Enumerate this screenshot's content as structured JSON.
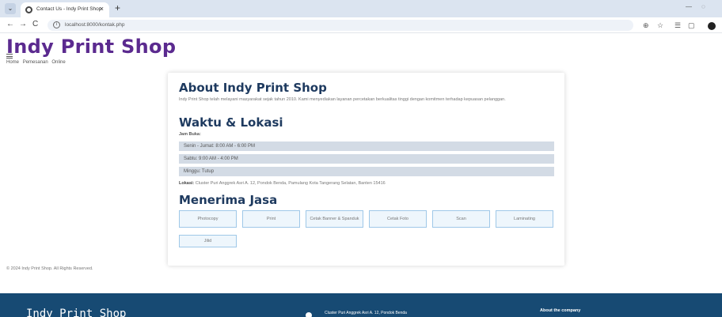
{
  "browser": {
    "tab_title": "Contact Us - Indy Print Shop",
    "tab_close": "×",
    "new_tab": "+",
    "url": "localhost:8000/kontak.php",
    "back": "←",
    "forward": "→",
    "reload": "C",
    "menu": "⌄",
    "minimize": "—",
    "restore": "◌"
  },
  "header": {
    "site_title": "Indy Print Shop",
    "nav": [
      "Home",
      "Pemesanan",
      "Online"
    ]
  },
  "about": {
    "heading": "About Indy Print Shop",
    "text": "Indy Print Shop telah melayani masyarakat sejak tahun 2010. Kami menyediakan layanan percetakan berkualitas tinggi dengan komitmen terhadap kepuasan pelanggan."
  },
  "hours": {
    "heading": "Waktu & Lokasi",
    "label": "Jam Buka:",
    "rows": [
      "Senin - Jumat: 8:00 AM - 6:00 PM",
      "Sabtu: 9:00 AM - 4:00 PM",
      "Minggu: Tutup"
    ],
    "location_label": "Lokasi:",
    "location": "Cluster Puri Anggrek Asri A. 12, Pondok Benda, Pamulang Kota Tangerang Selatan, Banten 15416"
  },
  "services": {
    "heading": "Menerima Jasa",
    "items": [
      "Photocopy",
      "Print",
      "Cetak Banner & Spanduk",
      "Cetak Foto",
      "Scan",
      "Laminating",
      "Jilid"
    ]
  },
  "copyright": "© 2024 Indy Print Shop. All Rights Reserved.",
  "footer": {
    "title": "Indy Print Shop",
    "address": "Cluster Puri Anggrek Asri A. 12, Pondok Benda",
    "about": "About the company"
  }
}
